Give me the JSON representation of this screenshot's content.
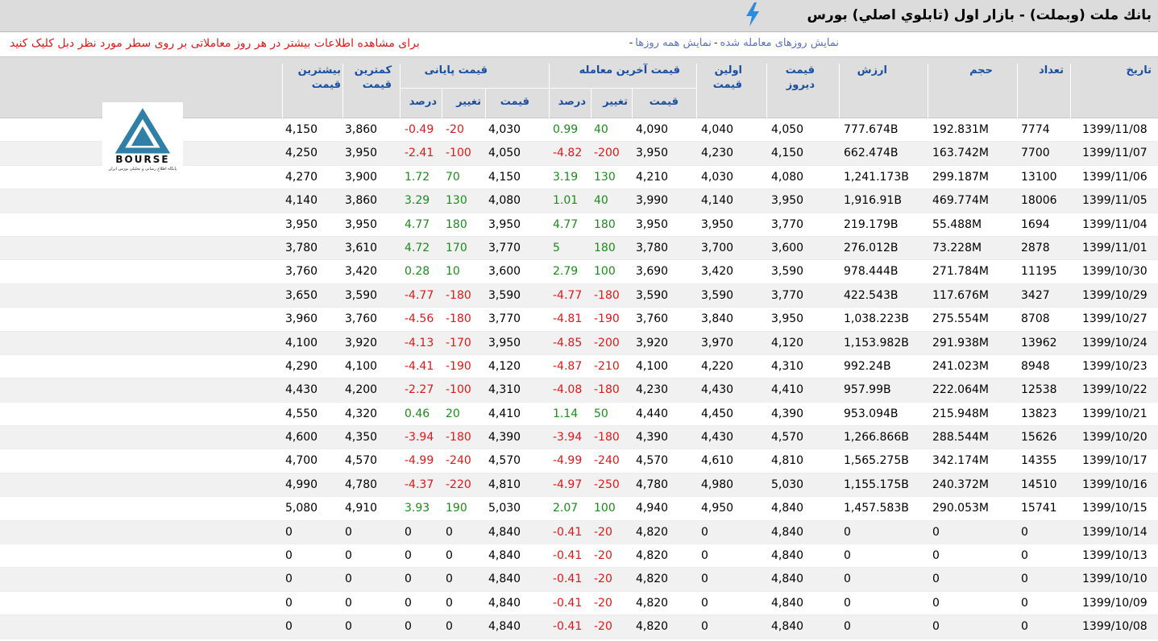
{
  "title": "بانك ملت (وبملت) - بازار اول (تابلوي اصلي) بورس",
  "links": {
    "traded_days": "نمایش روزهای معامله شده",
    "all_days": "نمایش همه روزها",
    "separator": "-"
  },
  "note": "برای مشاهده اطلاعات بیشتر در هر روز معاملاتی بر روی سطر مورد نظر دبل کلیک کنید",
  "logo": {
    "word": "BOURSE",
    "subtitle": "پایگاه اطلاع رسانی و تحلیلی بورس ایران"
  },
  "headers": {
    "date": "تاریخ",
    "count": "تعداد",
    "volume": "حجم",
    "value": "ارزش",
    "prev_price": "قیمت دیروز",
    "first_price": "اولین قیمت",
    "last_trade_group": "قیمت آخرین معامله",
    "closing_group": "قیمت پایانی",
    "low_price": "کمترین قیمت",
    "high_price": "بیشترین قیمت",
    "sub_price": "قیمت",
    "sub_change": "تغییر",
    "sub_percent": "درصد"
  },
  "colors": {
    "positive": "#1c8c1c",
    "negative": "#e01818",
    "header_text": "#1a4fa0"
  },
  "rows": [
    {
      "date": "1399/11/08",
      "count": "7774",
      "volume": "192.831M",
      "value": "777.674B",
      "prev": "4,050",
      "first": "4,040",
      "last_price": "4,090",
      "last_change": "40",
      "last_pct": "0.99",
      "close_price": "4,030",
      "close_change": "-20",
      "close_pct": "-0.49",
      "low": "3,860",
      "high": "4,150"
    },
    {
      "date": "1399/11/07",
      "count": "7700",
      "volume": "163.742M",
      "value": "662.474B",
      "prev": "4,150",
      "first": "4,230",
      "last_price": "3,950",
      "last_change": "-200",
      "last_pct": "-4.82",
      "close_price": "4,050",
      "close_change": "-100",
      "close_pct": "-2.41",
      "low": "3,950",
      "high": "4,250"
    },
    {
      "date": "1399/11/06",
      "count": "13100",
      "volume": "299.187M",
      "value": "1,241.173B",
      "prev": "4,080",
      "first": "4,030",
      "last_price": "4,210",
      "last_change": "130",
      "last_pct": "3.19",
      "close_price": "4,150",
      "close_change": "70",
      "close_pct": "1.72",
      "low": "3,900",
      "high": "4,270"
    },
    {
      "date": "1399/11/05",
      "count": "18006",
      "volume": "469.774M",
      "value": "1,916.91B",
      "prev": "3,950",
      "first": "4,140",
      "last_price": "3,990",
      "last_change": "40",
      "last_pct": "1.01",
      "close_price": "4,080",
      "close_change": "130",
      "close_pct": "3.29",
      "low": "3,860",
      "high": "4,140"
    },
    {
      "date": "1399/11/04",
      "count": "1694",
      "volume": "55.488M",
      "value": "219.179B",
      "prev": "3,770",
      "first": "3,950",
      "last_price": "3,950",
      "last_change": "180",
      "last_pct": "4.77",
      "close_price": "3,950",
      "close_change": "180",
      "close_pct": "4.77",
      "low": "3,950",
      "high": "3,950"
    },
    {
      "date": "1399/11/01",
      "count": "2878",
      "volume": "73.228M",
      "value": "276.012B",
      "prev": "3,600",
      "first": "3,700",
      "last_price": "3,780",
      "last_change": "180",
      "last_pct": "5",
      "close_price": "3,770",
      "close_change": "170",
      "close_pct": "4.72",
      "low": "3,610",
      "high": "3,780"
    },
    {
      "date": "1399/10/30",
      "count": "11195",
      "volume": "271.784M",
      "value": "978.444B",
      "prev": "3,590",
      "first": "3,420",
      "last_price": "3,690",
      "last_change": "100",
      "last_pct": "2.79",
      "close_price": "3,600",
      "close_change": "10",
      "close_pct": "0.28",
      "low": "3,420",
      "high": "3,760"
    },
    {
      "date": "1399/10/29",
      "count": "3427",
      "volume": "117.676M",
      "value": "422.543B",
      "prev": "3,770",
      "first": "3,590",
      "last_price": "3,590",
      "last_change": "-180",
      "last_pct": "-4.77",
      "close_price": "3,590",
      "close_change": "-180",
      "close_pct": "-4.77",
      "low": "3,590",
      "high": "3,650"
    },
    {
      "date": "1399/10/27",
      "count": "8708",
      "volume": "275.554M",
      "value": "1,038.223B",
      "prev": "3,950",
      "first": "3,840",
      "last_price": "3,760",
      "last_change": "-190",
      "last_pct": "-4.81",
      "close_price": "3,770",
      "close_change": "-180",
      "close_pct": "-4.56",
      "low": "3,760",
      "high": "3,960"
    },
    {
      "date": "1399/10/24",
      "count": "13962",
      "volume": "291.938M",
      "value": "1,153.982B",
      "prev": "4,120",
      "first": "3,970",
      "last_price": "3,920",
      "last_change": "-200",
      "last_pct": "-4.85",
      "close_price": "3,950",
      "close_change": "-170",
      "close_pct": "-4.13",
      "low": "3,920",
      "high": "4,100"
    },
    {
      "date": "1399/10/23",
      "count": "8948",
      "volume": "241.023M",
      "value": "992.24B",
      "prev": "4,310",
      "first": "4,220",
      "last_price": "4,100",
      "last_change": "-210",
      "last_pct": "-4.87",
      "close_price": "4,120",
      "close_change": "-190",
      "close_pct": "-4.41",
      "low": "4,100",
      "high": "4,290"
    },
    {
      "date": "1399/10/22",
      "count": "12538",
      "volume": "222.064M",
      "value": "957.99B",
      "prev": "4,410",
      "first": "4,430",
      "last_price": "4,230",
      "last_change": "-180",
      "last_pct": "-4.08",
      "close_price": "4,310",
      "close_change": "-100",
      "close_pct": "-2.27",
      "low": "4,200",
      "high": "4,430"
    },
    {
      "date": "1399/10/21",
      "count": "13823",
      "volume": "215.948M",
      "value": "953.094B",
      "prev": "4,390",
      "first": "4,450",
      "last_price": "4,440",
      "last_change": "50",
      "last_pct": "1.14",
      "close_price": "4,410",
      "close_change": "20",
      "close_pct": "0.46",
      "low": "4,320",
      "high": "4,550"
    },
    {
      "date": "1399/10/20",
      "count": "15626",
      "volume": "288.544M",
      "value": "1,266.866B",
      "prev": "4,570",
      "first": "4,430",
      "last_price": "4,390",
      "last_change": "-180",
      "last_pct": "-3.94",
      "close_price": "4,390",
      "close_change": "-180",
      "close_pct": "-3.94",
      "low": "4,350",
      "high": "4,600"
    },
    {
      "date": "1399/10/17",
      "count": "14355",
      "volume": "342.174M",
      "value": "1,565.275B",
      "prev": "4,810",
      "first": "4,610",
      "last_price": "4,570",
      "last_change": "-240",
      "last_pct": "-4.99",
      "close_price": "4,570",
      "close_change": "-240",
      "close_pct": "-4.99",
      "low": "4,570",
      "high": "4,700"
    },
    {
      "date": "1399/10/16",
      "count": "14510",
      "volume": "240.372M",
      "value": "1,155.175B",
      "prev": "5,030",
      "first": "4,980",
      "last_price": "4,780",
      "last_change": "-250",
      "last_pct": "-4.97",
      "close_price": "4,810",
      "close_change": "-220",
      "close_pct": "-4.37",
      "low": "4,780",
      "high": "4,990"
    },
    {
      "date": "1399/10/15",
      "count": "15741",
      "volume": "290.053M",
      "value": "1,457.583B",
      "prev": "4,840",
      "first": "4,950",
      "last_price": "4,940",
      "last_change": "100",
      "last_pct": "2.07",
      "close_price": "5,030",
      "close_change": "190",
      "close_pct": "3.93",
      "low": "4,910",
      "high": "5,080"
    },
    {
      "date": "1399/10/14",
      "count": "0",
      "volume": "0",
      "value": "0",
      "prev": "4,840",
      "first": "0",
      "last_price": "4,820",
      "last_change": "-20",
      "last_pct": "-0.41",
      "close_price": "4,840",
      "close_change": "0",
      "close_pct": "0",
      "low": "0",
      "high": "0"
    },
    {
      "date": "1399/10/13",
      "count": "0",
      "volume": "0",
      "value": "0",
      "prev": "4,840",
      "first": "0",
      "last_price": "4,820",
      "last_change": "-20",
      "last_pct": "-0.41",
      "close_price": "4,840",
      "close_change": "0",
      "close_pct": "0",
      "low": "0",
      "high": "0"
    },
    {
      "date": "1399/10/10",
      "count": "0",
      "volume": "0",
      "value": "0",
      "prev": "4,840",
      "first": "0",
      "last_price": "4,820",
      "last_change": "-20",
      "last_pct": "-0.41",
      "close_price": "4,840",
      "close_change": "0",
      "close_pct": "0",
      "low": "0",
      "high": "0"
    },
    {
      "date": "1399/10/09",
      "count": "0",
      "volume": "0",
      "value": "0",
      "prev": "4,840",
      "first": "0",
      "last_price": "4,820",
      "last_change": "-20",
      "last_pct": "-0.41",
      "close_price": "4,840",
      "close_change": "0",
      "close_pct": "0",
      "low": "0",
      "high": "0"
    },
    {
      "date": "1399/10/08",
      "count": "0",
      "volume": "0",
      "value": "0",
      "prev": "4,840",
      "first": "0",
      "last_price": "4,820",
      "last_change": "-20",
      "last_pct": "-0.41",
      "close_price": "4,840",
      "close_change": "0",
      "close_pct": "0",
      "low": "0",
      "high": "0"
    }
  ]
}
